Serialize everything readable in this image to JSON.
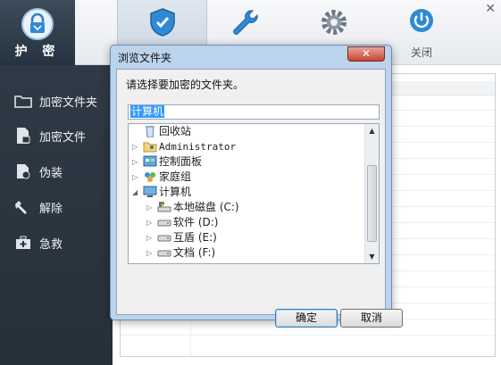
{
  "toolbar": {
    "protect_label": "护 密",
    "close_label": "关闭"
  },
  "sidebar": {
    "items": [
      {
        "label": "加密文件夹",
        "icon": "folder-icon"
      },
      {
        "label": "加密文件",
        "icon": "file-lock-icon"
      },
      {
        "label": "伪装",
        "icon": "disguise-icon"
      },
      {
        "label": "解除",
        "icon": "unlock-icon"
      },
      {
        "label": "急救",
        "icon": "first-aid-icon"
      }
    ]
  },
  "dialog": {
    "title": "浏览文件夹",
    "close_glyph": "✕",
    "prompt": "请选择要加密的文件夹。",
    "path_value": "计算机",
    "tree": [
      {
        "label": "回收站",
        "icon": "recycle-bin-icon",
        "expander": ""
      },
      {
        "label": "Administrator",
        "icon": "user-folder-icon",
        "expander": "▷"
      },
      {
        "label": "控制面板",
        "icon": "control-panel-icon",
        "expander": "▷"
      },
      {
        "label": "家庭组",
        "icon": "homegroup-icon",
        "expander": "▷"
      },
      {
        "label": "计算机",
        "icon": "computer-icon",
        "expander": "◢"
      },
      {
        "label": "本地磁盘 (C:)",
        "icon": "system-drive-icon",
        "expander": "▷"
      },
      {
        "label": "软件 (D:)",
        "icon": "drive-icon",
        "expander": "▷"
      },
      {
        "label": "互盾 (E:)",
        "icon": "drive-icon",
        "expander": "▷"
      },
      {
        "label": "文档 (F:)",
        "icon": "drive-icon",
        "expander": "▷"
      }
    ],
    "ok_label": "确定",
    "cancel_label": "取消"
  },
  "colors": {
    "sidebar_bg": "#2b3540",
    "dialog_frame": "#bcd3ec",
    "selection": "#3399ff",
    "close_button": "#c8442f"
  }
}
